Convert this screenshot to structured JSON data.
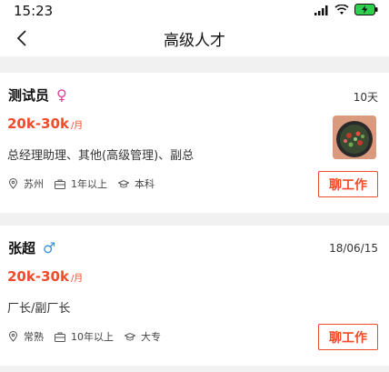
{
  "status": {
    "time": "15:23",
    "signal_icon": "signal-bars-icon",
    "wifi_icon": "wifi-icon",
    "battery_icon": "battery-charging-icon",
    "battery_color": "#2fcf4f"
  },
  "header": {
    "title": "高级人才",
    "back_icon": "chevron-left-icon"
  },
  "colors": {
    "accent": "#f04b2a",
    "female": "#e0409a",
    "male": "#3b8fe0"
  },
  "candidates": [
    {
      "name": "测试员",
      "gender_symbol": "♀",
      "time": "10天",
      "salary": "20k-30k",
      "salary_unit": "/月",
      "positions": "总经理助理、其他(高级管理)、副总",
      "city": "苏州",
      "experience": "1年以上",
      "education": "本科",
      "action": "聊工作",
      "has_photo": true
    },
    {
      "name": "张超",
      "gender_symbol": "♂",
      "time": "18/06/15",
      "salary": "20k-30k",
      "salary_unit": "/月",
      "positions": "厂长/副厂长",
      "city": "常熟",
      "experience": "10年以上",
      "education": "大专",
      "action": "聊工作",
      "has_photo": false
    }
  ]
}
